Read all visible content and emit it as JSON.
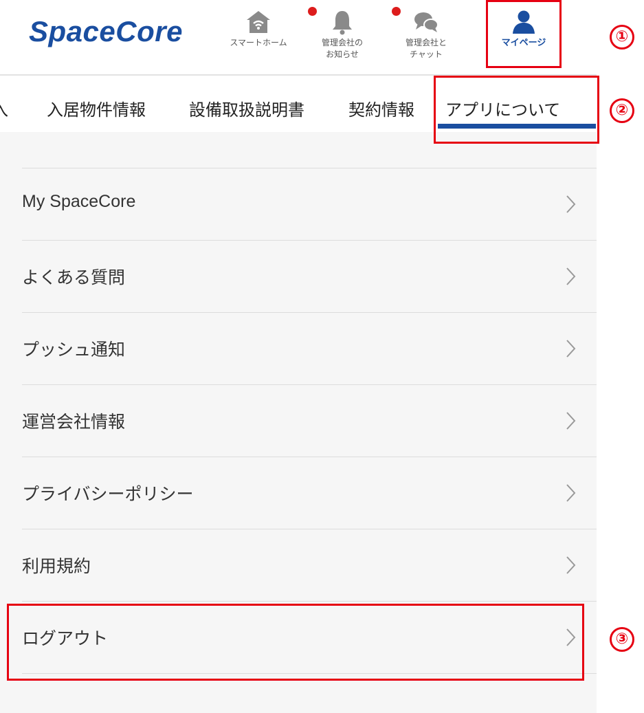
{
  "header": {
    "logo": "SpaceCore",
    "nav": [
      {
        "label": "スマートホーム",
        "icon": "home-wifi-icon",
        "badge": false
      },
      {
        "label": "管理会社の\nお知らせ",
        "icon": "bell-icon",
        "badge": true
      },
      {
        "label": "管理会社と\nチャット",
        "icon": "chat-bubbles-icon",
        "badge": true
      },
      {
        "label": "マイページ",
        "icon": "person-icon",
        "badge": false,
        "active": true
      }
    ]
  },
  "tabs": {
    "partial": "入",
    "items": [
      "入居物件情報",
      "設備取扱説明書",
      "契約情報",
      "アプリについて"
    ],
    "active_index": 3
  },
  "menu": {
    "items": [
      "My SpaceCore",
      "よくある質問",
      "プッシュ通知",
      "運営会社情報",
      "プライバシーポリシー",
      "利用規約",
      "ログアウト"
    ]
  },
  "annotations": [
    "①",
    "②",
    "③"
  ],
  "colors": {
    "brand": "#1a4ea0",
    "badge": "#dd1c1c",
    "annotation": "#e60012",
    "background": "#f6f6f6"
  }
}
